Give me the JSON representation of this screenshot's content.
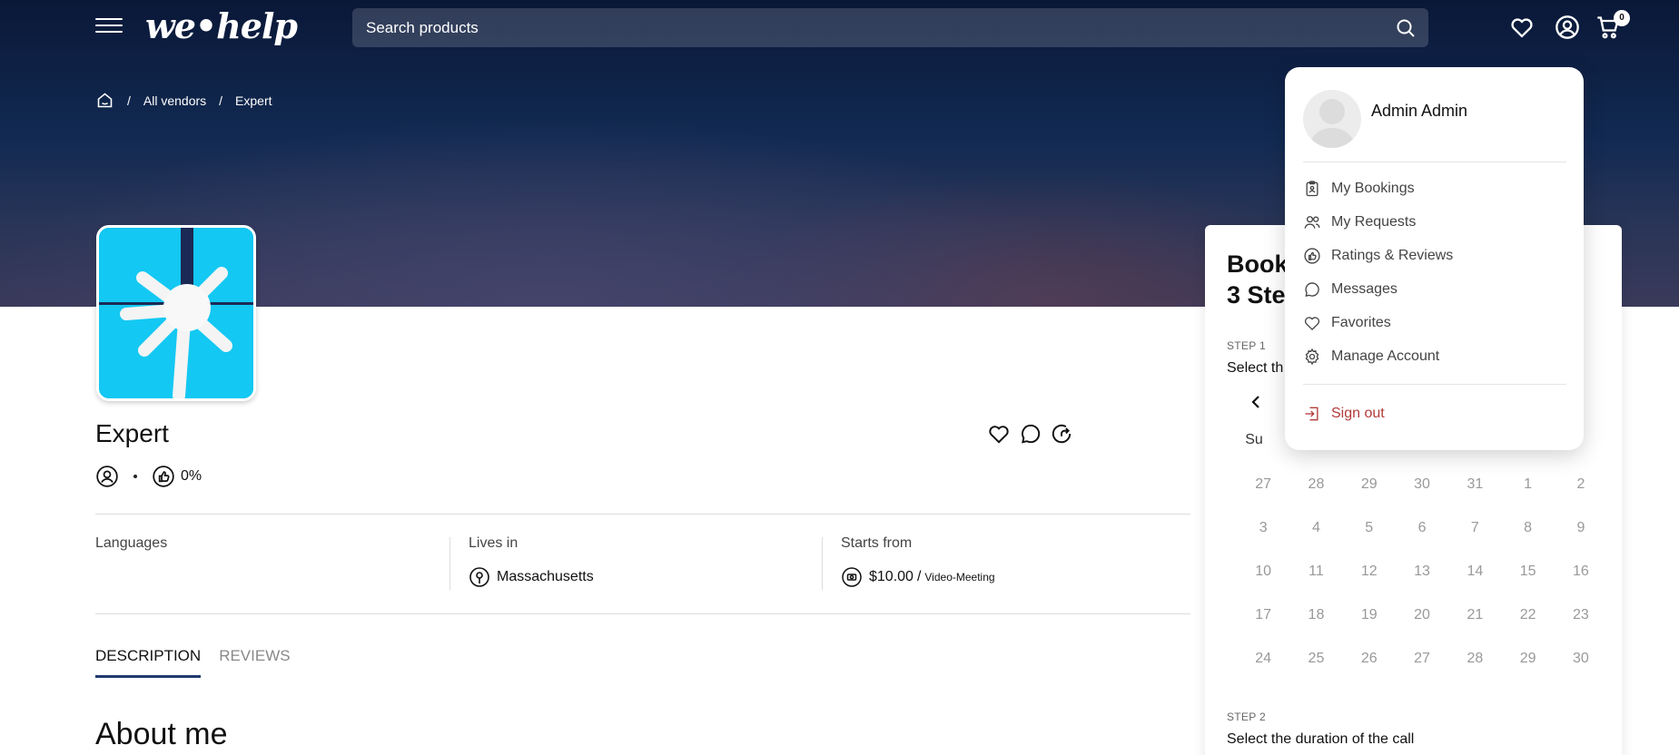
{
  "header": {
    "logo_text": "we•help",
    "search_placeholder": "Search products",
    "cart_count": "0"
  },
  "breadcrumb": {
    "items": [
      "All vendors",
      "Expert"
    ]
  },
  "vendor": {
    "name": "Expert",
    "rating_percent": "0%"
  },
  "info": {
    "languages_label": "Languages",
    "lives_label": "Lives in",
    "lives_value": "Massachusetts",
    "starts_label": "Starts from",
    "price": "$10.00",
    "price_sep": "/",
    "price_unit": "Video-Meeting"
  },
  "tabs": [
    "DESCRIPTION",
    "REVIEWS"
  ],
  "about_heading": "About me",
  "booking": {
    "title": "Book\n3 Ste",
    "step1_label": "STEP 1",
    "step1_text": "Select th",
    "weekday_su": "Su",
    "days": [
      "27",
      "28",
      "29",
      "30",
      "31",
      "1",
      "2",
      "3",
      "4",
      "5",
      "6",
      "7",
      "8",
      "9",
      "10",
      "11",
      "12",
      "13",
      "14",
      "15",
      "16",
      "17",
      "18",
      "19",
      "20",
      "21",
      "22",
      "23",
      "24",
      "25",
      "26",
      "27",
      "28",
      "29",
      "30"
    ],
    "step2_label": "STEP 2",
    "step2_text": "Select the duration of the call"
  },
  "user_menu": {
    "name": "Admin Admin",
    "items": [
      "My Bookings",
      "My Requests",
      "Ratings & Reviews",
      "Messages",
      "Favorites",
      "Manage Account"
    ],
    "signout": "Sign out"
  },
  "colors": {
    "accent_tab": "#1f3a6e",
    "signout": "#b33a3a",
    "avatar_bg": "#13c8f2"
  }
}
